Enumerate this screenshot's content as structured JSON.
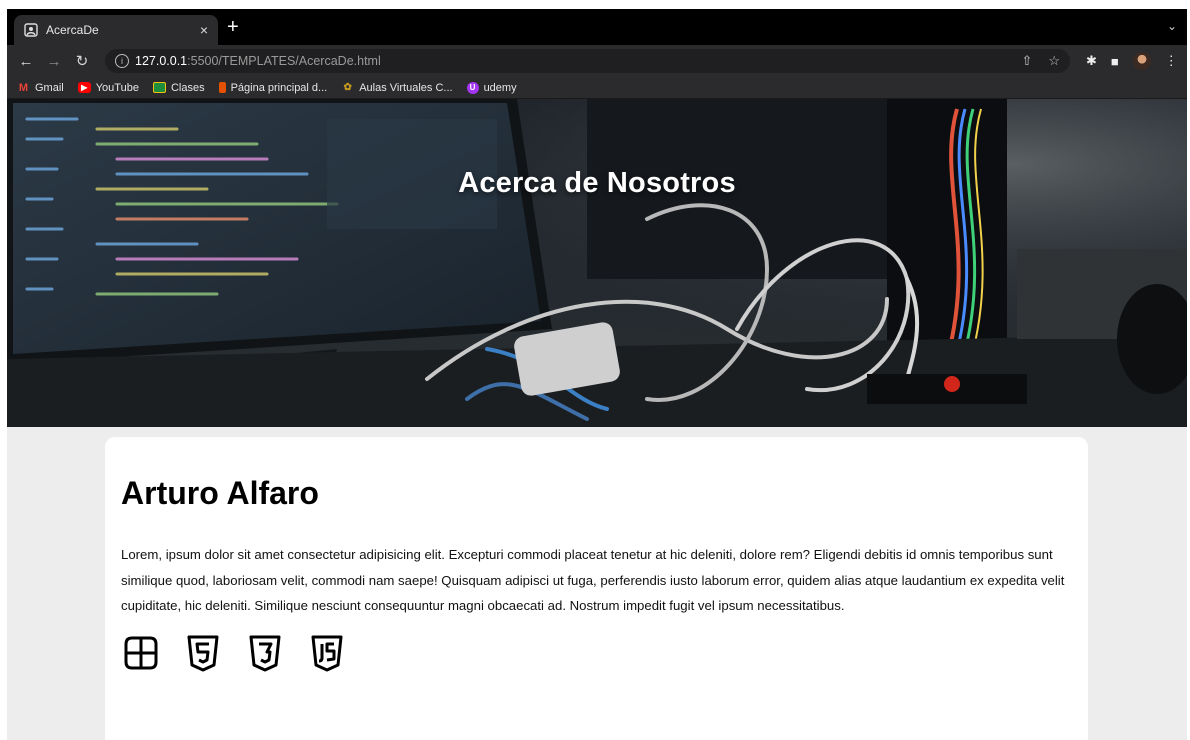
{
  "browser": {
    "tab_title": "AcercaDe",
    "tab_close": "×",
    "new_tab": "+",
    "tab_menu": "⌄",
    "url_host": "127.0.0.1",
    "url_path": ":5500/TEMPLATES/AcercaDe.html",
    "bookmarks": [
      {
        "label": "Gmail",
        "icon": "gmail-icon",
        "color": "#ea4335"
      },
      {
        "label": "YouTube",
        "icon": "youtube-icon",
        "color": "#ff0000"
      },
      {
        "label": "Clases",
        "icon": "classroom-icon",
        "color": "#1e8e3e"
      },
      {
        "label": "Página principal d...",
        "icon": "page-icon",
        "color": "#e65100"
      },
      {
        "label": "Aulas Virtuales C...",
        "icon": "aulas-icon",
        "color": "#c59a1f"
      },
      {
        "label": "udemy",
        "icon": "udemy-icon",
        "color": "#a435f0"
      }
    ]
  },
  "hero": {
    "title": "Acerca de Nosotros"
  },
  "profile": {
    "name": "Arturo Alfaro",
    "bio": "Lorem, ipsum dolor sit amet consectetur adipisicing elit. Excepturi commodi placeat tenetur at hic deleniti, dolore rem? Eligendi debitis id omnis temporibus sunt similique quod, laboriosam velit, commodi nam saepe! Quisquam adipisci ut fuga, perferendis iusto laborum error, quidem alias atque laudantium ex expedita velit cupiditate, hic deleniti. Similique nesciunt consequuntur magni obcaecati ad. Nostrum impedit fugit vel ipsum necessitatibus.",
    "tech_icons": [
      "windows-icon",
      "html5-icon",
      "css3-icon",
      "javascript-icon"
    ]
  }
}
